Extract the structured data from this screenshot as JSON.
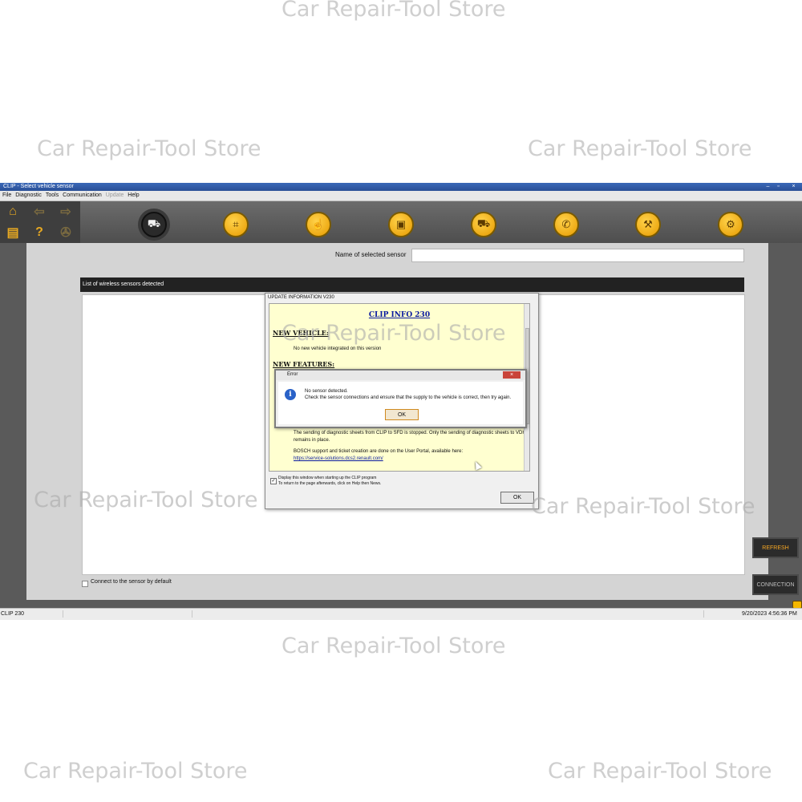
{
  "watermark": "Car Repair-Tool Store",
  "window": {
    "title": "CLIP - Select vehicle sensor",
    "controls": [
      "–",
      "▫",
      "×"
    ]
  },
  "menu": [
    {
      "label": "File",
      "enabled": true
    },
    {
      "label": "Diagnostic",
      "enabled": true
    },
    {
      "label": "Tools",
      "enabled": true
    },
    {
      "label": "Communication",
      "enabled": true
    },
    {
      "label": "Update",
      "enabled": false
    },
    {
      "label": "Help",
      "enabled": true
    }
  ],
  "toolbar": {
    "left_icons": [
      "home-icon",
      "back-arrow-icon",
      "forward-arrow-icon",
      "printer-icon",
      "help-icon",
      "disabled-tool-icon"
    ],
    "main_icons": [
      "vehicle-sensor-icon",
      "gearbox-icon",
      "touch-icon",
      "dashboard-icon",
      "vehicle-icon",
      "phone-icon",
      "wrench-icon",
      "vehicle-settings-icon"
    ],
    "glyphs": {
      "home": "⌂",
      "back": "⇦",
      "forward": "⇨",
      "printer": "▤",
      "help": "?",
      "tool": "✇",
      "sensor": "⛟",
      "gearbox": "⌗",
      "touch": "☝",
      "dash": "▣",
      "vehicle": "⛟",
      "phone": "✆",
      "wrench": "⚒",
      "settings": "⚙"
    },
    "accent": "#f5b800"
  },
  "sensor_panel": {
    "name_label": "Name of selected sensor",
    "name_value": "",
    "list_header": "List of wireless sensors detected",
    "checkbox_label": "Connect to the sensor by default",
    "checkbox_checked": false
  },
  "buttons": {
    "refresh": "REFRESH",
    "connection": "CONNECTION",
    "refresh_color": "#f5a623",
    "connection_color": "#bfbfbf"
  },
  "update_dialog": {
    "title": "UPDATE INFORMATION  V230",
    "heading": "CLIP INFO 230",
    "section_vehicle": "NEW VEHICLE:",
    "vehicle_text": "No new vehicle integrated on this version",
    "section_features": "NEW FEATURES:",
    "para_sending": "The sending of diagnostic sheets from CLIP to SFD is stopped. Only the sending of diagnostic sheets to VDH remains in place.",
    "para_bosch": "BOSCH support and ticket creation are done on the User Portal, available here:",
    "link": "https://service-solutions.dcs2.renault.com/",
    "checkbox_label": "Display this window when starting up the CLIP program",
    "checkbox_hint": "To return to the page afterwards, click on Help then News.",
    "checkbox_checked": true,
    "ok": "OK"
  },
  "error_dialog": {
    "title": "Error",
    "message_title": "No sensor detected.",
    "message_body": "Check the sensor connections and ensure that the supply to the vehicle is correct, then try again.",
    "ok": "OK",
    "icon": "i"
  },
  "status": {
    "left": "CLIP 230",
    "right": "9/20/2023 4:56:36 PM"
  }
}
